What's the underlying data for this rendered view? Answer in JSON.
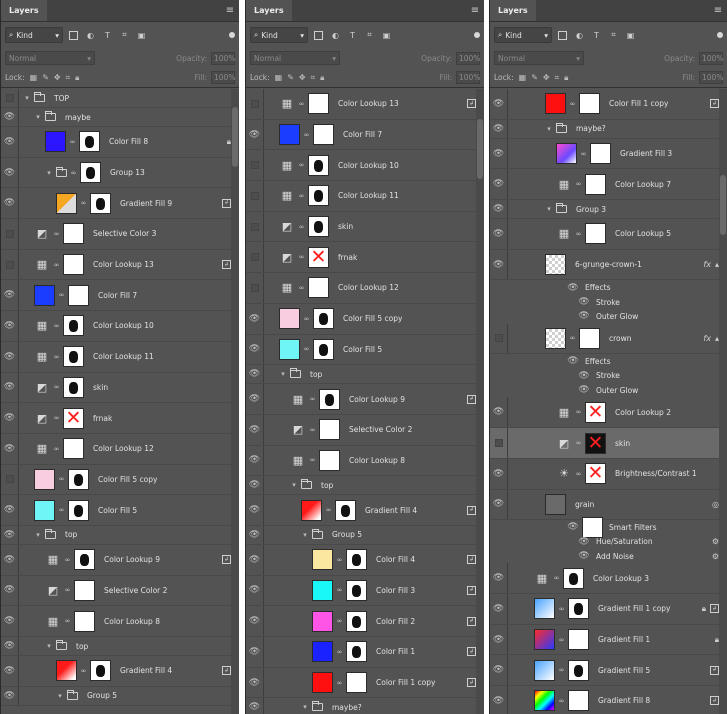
{
  "common": {
    "tab": "Layers",
    "kind": "Kind",
    "blend": "Normal",
    "opacity_label": "Opacity:",
    "opacity_value": "100%",
    "lock_label": "Lock:",
    "fill_label": "Fill:",
    "fill_value": "100%"
  },
  "panel1": {
    "layers": [
      {
        "type": "group",
        "indent": 0,
        "name": "TOP",
        "eye": false
      },
      {
        "type": "group",
        "indent": 1,
        "name": "maybe",
        "eye": true
      },
      {
        "type": "layer",
        "indent": 2,
        "thumb": "#2b16ff",
        "mask": "blob",
        "name": "Color Fill 8",
        "eye": true,
        "right": "lock"
      },
      {
        "type": "layer",
        "indent": 2,
        "thumb": "folder",
        "mask": "blob",
        "name": "Group 13",
        "eye": true,
        "folder": true
      },
      {
        "type": "layer",
        "indent": 3,
        "thumb": "gradient-yellow",
        "mask": "blob",
        "name": "Gradient Fill 9",
        "eye": true,
        "right": "clip"
      },
      {
        "type": "layer",
        "indent": 1,
        "thumb": "adj-sel",
        "mask": "white",
        "name": "Selective Color 3",
        "eye": false
      },
      {
        "type": "layer",
        "indent": 1,
        "thumb": "adj-lookup",
        "mask": "white",
        "name": "Color Lookup 13",
        "eye": false,
        "right": "clip"
      },
      {
        "type": "layer",
        "indent": 1,
        "thumb": "#1a3dff",
        "mask": "white",
        "name": "Color Fill 7",
        "eye": true
      },
      {
        "type": "layer",
        "indent": 1,
        "thumb": "adj-lookup",
        "mask": "blob",
        "name": "Color Lookup 10",
        "eye": true
      },
      {
        "type": "layer",
        "indent": 1,
        "thumb": "adj-lookup",
        "mask": "blob",
        "name": "Color Lookup 11",
        "eye": true
      },
      {
        "type": "layer",
        "indent": 1,
        "thumb": "adj-sel",
        "mask": "blob",
        "name": "skin",
        "eye": true
      },
      {
        "type": "layer",
        "indent": 1,
        "thumb": "adj-sel",
        "mask": "x",
        "name": "frnak",
        "eye": true
      },
      {
        "type": "layer",
        "indent": 1,
        "thumb": "adj-lookup",
        "mask": "white",
        "name": "Color Lookup 12",
        "eye": true
      },
      {
        "type": "layer",
        "indent": 1,
        "thumb": "#f9cde0",
        "mask": "blob",
        "name": "Color Fill 5 copy",
        "eye": false
      },
      {
        "type": "layer",
        "indent": 1,
        "thumb": "#6ff5f5",
        "mask": "blob",
        "name": "Color Fill 5",
        "eye": true
      },
      {
        "type": "group",
        "indent": 1,
        "name": "top",
        "eye": true
      },
      {
        "type": "layer",
        "indent": 2,
        "thumb": "adj-lookup",
        "mask": "blob",
        "name": "Color Lookup 9",
        "eye": true,
        "right": "clip"
      },
      {
        "type": "layer",
        "indent": 2,
        "thumb": "adj-sel",
        "mask": "white",
        "name": "Selective Color 2",
        "eye": true
      },
      {
        "type": "layer",
        "indent": 2,
        "thumb": "adj-lookup",
        "mask": "white",
        "name": "Color Lookup 8",
        "eye": true
      },
      {
        "type": "group",
        "indent": 2,
        "name": "top",
        "eye": true
      },
      {
        "type": "layer",
        "indent": 3,
        "thumb": "gradient-red",
        "mask": "blob",
        "name": "Gradient Fill 4",
        "eye": true,
        "right": "clip"
      },
      {
        "type": "group",
        "indent": 3,
        "name": "Group 5",
        "eye": true
      }
    ]
  },
  "panel2": {
    "layers": [
      {
        "type": "layer",
        "indent": 1,
        "thumb": "adj-lookup",
        "mask": "white",
        "name": "Color Lookup 13",
        "eye": false,
        "right": "clip"
      },
      {
        "type": "layer",
        "indent": 1,
        "thumb": "#1a3dff",
        "mask": "white",
        "name": "Color Fill 7",
        "eye": true
      },
      {
        "type": "layer",
        "indent": 1,
        "thumb": "adj-lookup",
        "mask": "blob",
        "name": "Color Lookup 10",
        "eye": false
      },
      {
        "type": "layer",
        "indent": 1,
        "thumb": "adj-lookup",
        "mask": "blob",
        "name": "Color Lookup 11",
        "eye": false
      },
      {
        "type": "layer",
        "indent": 1,
        "thumb": "adj-sel",
        "mask": "blob",
        "name": "skin",
        "eye": false
      },
      {
        "type": "layer",
        "indent": 1,
        "thumb": "adj-sel",
        "mask": "x",
        "name": "frnak",
        "eye": false
      },
      {
        "type": "layer",
        "indent": 1,
        "thumb": "adj-lookup",
        "mask": "white",
        "name": "Color Lookup 12",
        "eye": false
      },
      {
        "type": "layer",
        "indent": 1,
        "thumb": "#f9cde0",
        "mask": "blob",
        "name": "Color Fill 5 copy",
        "eye": true
      },
      {
        "type": "layer",
        "indent": 1,
        "thumb": "#6ff5f5",
        "mask": "blob",
        "name": "Color Fill 5",
        "eye": true
      },
      {
        "type": "group",
        "indent": 1,
        "name": "top",
        "eye": true
      },
      {
        "type": "layer",
        "indent": 2,
        "thumb": "adj-lookup",
        "mask": "blob",
        "name": "Color Lookup 9",
        "eye": true,
        "right": "clip"
      },
      {
        "type": "layer",
        "indent": 2,
        "thumb": "adj-sel",
        "mask": "white",
        "name": "Selective Color 2",
        "eye": true
      },
      {
        "type": "layer",
        "indent": 2,
        "thumb": "adj-lookup",
        "mask": "white",
        "name": "Color Lookup 8",
        "eye": true
      },
      {
        "type": "group",
        "indent": 2,
        "name": "top",
        "eye": true
      },
      {
        "type": "layer",
        "indent": 3,
        "thumb": "gradient-red",
        "mask": "blob",
        "name": "Gradient Fill 4",
        "eye": true,
        "right": "clip"
      },
      {
        "type": "group",
        "indent": 3,
        "name": "Group 5",
        "eye": true
      },
      {
        "type": "layer",
        "indent": 4,
        "thumb": "#fce7a0",
        "mask": "blob",
        "name": "Color Fill 4",
        "eye": true,
        "right": "clip"
      },
      {
        "type": "layer",
        "indent": 4,
        "thumb": "#19f7f7",
        "mask": "blob",
        "name": "Color Fill 3",
        "eye": true,
        "right": "clip"
      },
      {
        "type": "layer",
        "indent": 4,
        "thumb": "#ff55e6",
        "mask": "blob",
        "name": "Color Fill 2",
        "eye": true,
        "right": "clip"
      },
      {
        "type": "layer",
        "indent": 4,
        "thumb": "#1a22ff",
        "mask": "blob",
        "name": "Color Fill 1",
        "eye": true,
        "right": "clip"
      },
      {
        "type": "layer",
        "indent": 4,
        "thumb": "#ff1010",
        "mask": "white",
        "name": "Color Fill 1 copy",
        "eye": true,
        "right": "clip"
      },
      {
        "type": "group",
        "indent": 3,
        "name": "maybe?",
        "eye": true
      }
    ]
  },
  "panel3": {
    "layers": [
      {
        "type": "layer",
        "indent": 3,
        "thumb": "#ff1010",
        "mask": "white",
        "name": "Color Fill 1 copy",
        "eye": true,
        "right": "clip"
      },
      {
        "type": "group",
        "indent": 3,
        "name": "maybe?",
        "eye": true
      },
      {
        "type": "layer",
        "indent": 4,
        "thumb": "gradient-purple",
        "mask": "white",
        "name": "Gradient Fill 3",
        "eye": true
      },
      {
        "type": "layer",
        "indent": 4,
        "thumb": "adj-lookup",
        "mask": "white",
        "name": "Color Lookup 7",
        "eye": true
      },
      {
        "type": "group",
        "indent": 3,
        "name": "Group 3",
        "eye": true
      },
      {
        "type": "layer",
        "indent": 4,
        "thumb": "adj-lookup",
        "mask": "white",
        "name": "Color Lookup 5",
        "eye": true
      },
      {
        "type": "layer",
        "indent": 3,
        "thumb": "checker",
        "mask": "none",
        "name": "6-grunge-crown-1",
        "eye": true,
        "right": "fx"
      },
      {
        "type": "effect",
        "indent": 5,
        "name": "Effects"
      },
      {
        "type": "effect",
        "indent": 6,
        "name": "Stroke"
      },
      {
        "type": "effect",
        "indent": 6,
        "name": "Outer Glow"
      },
      {
        "type": "layer",
        "indent": 3,
        "thumb": "checker",
        "mask": "white",
        "name": "crown",
        "eye": false,
        "right": "fx"
      },
      {
        "type": "effect",
        "indent": 5,
        "name": "Effects"
      },
      {
        "type": "effect",
        "indent": 6,
        "name": "Stroke"
      },
      {
        "type": "effect",
        "indent": 6,
        "name": "Outer Glow"
      },
      {
        "type": "layer",
        "indent": 4,
        "thumb": "adj-lookup",
        "mask": "x",
        "name": "Color Lookup 2",
        "eye": true
      },
      {
        "type": "layer",
        "indent": 4,
        "thumb": "adj-sel",
        "mask": "xdark",
        "name": "skin",
        "eye": false,
        "selected": true
      },
      {
        "type": "layer",
        "indent": 4,
        "thumb": "adj-bright",
        "mask": "x",
        "name": "Brightness/Contrast 1",
        "eye": true
      },
      {
        "type": "layer",
        "indent": 3,
        "thumb": "grain",
        "mask": "none",
        "name": "grain",
        "eye": true,
        "right": "smart"
      },
      {
        "type": "effect",
        "indent": 5,
        "thumb": "white",
        "name": "Smart Filters"
      },
      {
        "type": "effect",
        "indent": 6,
        "name": "Hue/Saturation",
        "right": "adjust"
      },
      {
        "type": "effect",
        "indent": 6,
        "name": "Add Noise",
        "right": "adjust"
      },
      {
        "type": "layer",
        "indent": 2,
        "thumb": "adj-lookup",
        "mask": "blob",
        "name": "Color Lookup 3",
        "eye": true
      },
      {
        "type": "layer",
        "indent": 2,
        "thumb": "gradient-blue",
        "mask": "blob",
        "name": "Gradient Fill 1 copy",
        "eye": true,
        "right": "lockclip"
      },
      {
        "type": "layer",
        "indent": 2,
        "thumb": "gradient-redblue",
        "mask": "white",
        "name": "Gradient Fill 1",
        "eye": true,
        "right": "lock"
      },
      {
        "type": "layer",
        "indent": 2,
        "thumb": "gradient-blue",
        "mask": "blob",
        "name": "Gradient Fill 5",
        "eye": true,
        "right": "clip"
      },
      {
        "type": "layer",
        "indent": 2,
        "thumb": "rainbow",
        "mask": "white",
        "name": "Gradient Fill 8",
        "eye": true,
        "right": "clip"
      }
    ]
  }
}
